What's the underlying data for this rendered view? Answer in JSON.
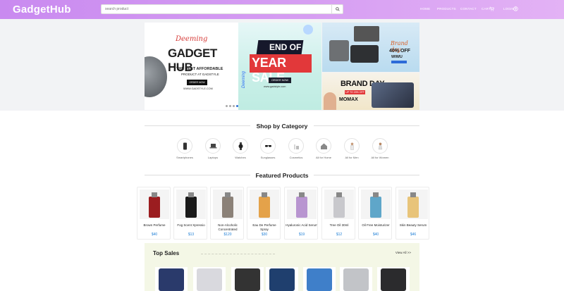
{
  "header": {
    "logo": "GadgetHub",
    "search_placeholder": "search product",
    "nav": [
      "HOME",
      "PRODUCTS",
      "CONTACT",
      "CART",
      "LOGIN"
    ]
  },
  "hero": {
    "banner1": {
      "script": "Deeming",
      "title": "GADGET HUB",
      "subtitle": "THE BEST AFFORDABLE",
      "subtitle2": "PRODUCT AT GADSTYLE",
      "button": "ORDER NOW",
      "url": "WWW.GADSTYLE.COM"
    },
    "banner2": {
      "line1": "END OF",
      "line2": "YEAR SALE",
      "button": "ORDER NOW",
      "url": "www.gadstyle.com",
      "side": "Deeming"
    },
    "banner3": {
      "script": "Brand day",
      "offer": "40% OFF",
      "brand": "WIWU"
    },
    "banner4": {
      "title": "BRAND DAY",
      "sub": "UP TO 20% OFF",
      "brand": "MOMAX"
    },
    "slide_count": 4,
    "active_slide": 4
  },
  "categories": {
    "title": "Shop by Category",
    "items": [
      {
        "label": "Smartphones",
        "icon": "smartphone-icon"
      },
      {
        "label": "Laptops",
        "icon": "laptop-icon"
      },
      {
        "label": "Watches",
        "icon": "watch-icon"
      },
      {
        "label": "Sunglasses",
        "icon": "sunglasses-icon"
      },
      {
        "label": "Cosmetics",
        "icon": "cosmetics-icon"
      },
      {
        "label": "All for Home",
        "icon": "home-icon"
      },
      {
        "label": "All for Men",
        "icon": "man-icon"
      },
      {
        "label": "All for Women",
        "icon": "woman-icon"
      }
    ]
  },
  "featured": {
    "title": "Featured Products",
    "items": [
      {
        "name": "Brown Perfume",
        "price": "$40",
        "color": "#9b1d20"
      },
      {
        "name": "Fog Scent Xpressio",
        "price": "$13",
        "color": "#1a1a1a"
      },
      {
        "name": "Non-Alcoholic Concentrated",
        "price": "$120",
        "color": "#8b8178"
      },
      {
        "name": "Eau De Perfume Spray",
        "price": "$30",
        "color": "#e4a24a"
      },
      {
        "name": "Hyaluronic Acid Serum",
        "price": "$19",
        "color": "#b895d0"
      },
      {
        "name": "Tree Oil 30ml",
        "price": "$12",
        "color": "#c8c8cc"
      },
      {
        "name": "Oil Free Moisturizer",
        "price": "$40",
        "color": "#5fa6c9"
      },
      {
        "name": "Skin Beauty Serum",
        "price": "$46",
        "color": "#e8c47a"
      }
    ]
  },
  "top_sales": {
    "title": "Top Sales",
    "view_all": "View All >>",
    "items": [
      {
        "color": "#2a3a6b"
      },
      {
        "color": "#d9d9de"
      },
      {
        "color": "#333333"
      },
      {
        "color": "#1f3f6e"
      },
      {
        "color": "#3f7fc9"
      },
      {
        "color": "#c2c4c8"
      },
      {
        "color": "#2b2b2d"
      }
    ]
  },
  "colors": {
    "header_gradient_start": "#c98af0",
    "header_gradient_end": "#e3b2f5",
    "price": "#1f7fd6",
    "top_sales_bg": "#f4f7e6"
  }
}
